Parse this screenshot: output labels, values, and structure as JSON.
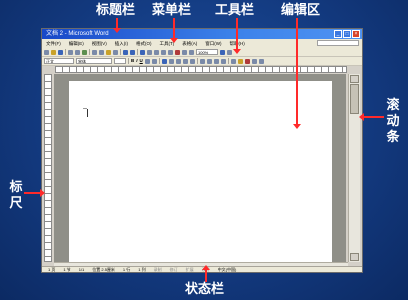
{
  "callouts": {
    "title_bar": "标题栏",
    "menu_bar": "菜单栏",
    "toolbar": "工具栏",
    "edit_area": "编辑区",
    "ruler": "标尺",
    "scrollbar": "滚动条",
    "status_bar": "状态栏"
  },
  "window": {
    "title": "文档 2 - Microsoft Word",
    "controls": [
      "_",
      "□",
      "×"
    ]
  },
  "menu": {
    "items": [
      "文件(F)",
      "编辑(E)",
      "视图(V)",
      "插入(I)",
      "格式(O)",
      "工具(T)",
      "表格(A)",
      "窗口(W)",
      "帮助(H)"
    ]
  },
  "toolbar2": {
    "style": "正文",
    "font": "宋体",
    "zoom": "100%",
    "bold": "B",
    "italic": "I",
    "underline": "U"
  },
  "status": {
    "items": [
      "1 页",
      "1 节",
      "1/1",
      "位置 2.5厘米",
      "1 行",
      "1 列",
      "录制",
      "修订",
      "扩展",
      "改写",
      "中文(中国)"
    ]
  },
  "colors": {
    "background": "#133a80",
    "callout_arrow": "#ff2a2a",
    "titlebar": "#1848c8"
  }
}
